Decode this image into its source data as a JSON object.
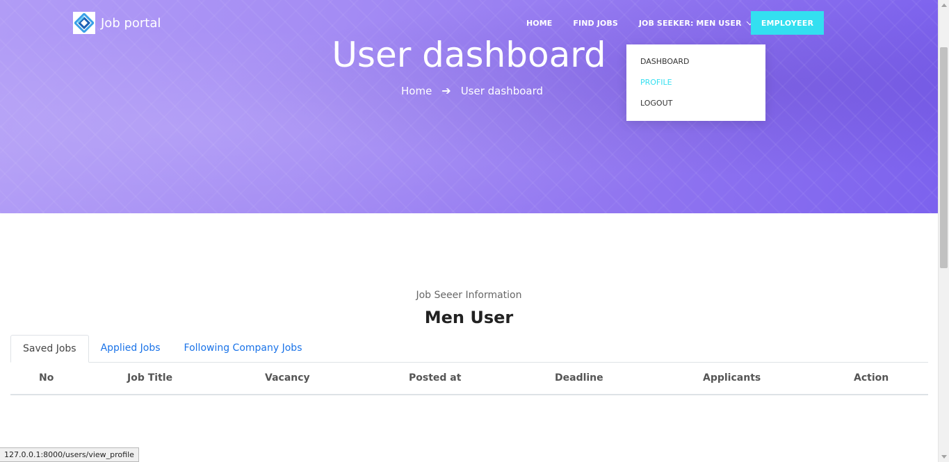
{
  "brand": {
    "name": "Job portal"
  },
  "nav": {
    "home": "HOME",
    "find_jobs": "FIND JOBS",
    "user_menu": "JOB SEEKER: MEN USER",
    "employer_button": "EMPLOYEER"
  },
  "dropdown": {
    "items": [
      "DASHBOARD",
      "PROFILE",
      "LOGOUT"
    ],
    "active": "PROFILE"
  },
  "hero": {
    "title": "User dashboard",
    "breadcrumb": [
      "Home",
      "User dashboard"
    ]
  },
  "profile": {
    "label": "Job Seeer Information",
    "name": "Men User"
  },
  "tabs": [
    "Saved Jobs",
    "Applied Jobs",
    "Following Company Jobs"
  ],
  "active_tab": "Saved Jobs",
  "table": {
    "columns": [
      "No",
      "Job Title",
      "Vacancy",
      "Posted at",
      "Deadline",
      "Applicants",
      "Action"
    ],
    "rows": []
  },
  "status_bar": {
    "url": "127.0.0.1:8000/users/view_profile"
  },
  "colors": {
    "accent": "#33dff0",
    "hero_start": "#b19cf6",
    "hero_end": "#7c62ee",
    "link": "#1a73e8"
  }
}
